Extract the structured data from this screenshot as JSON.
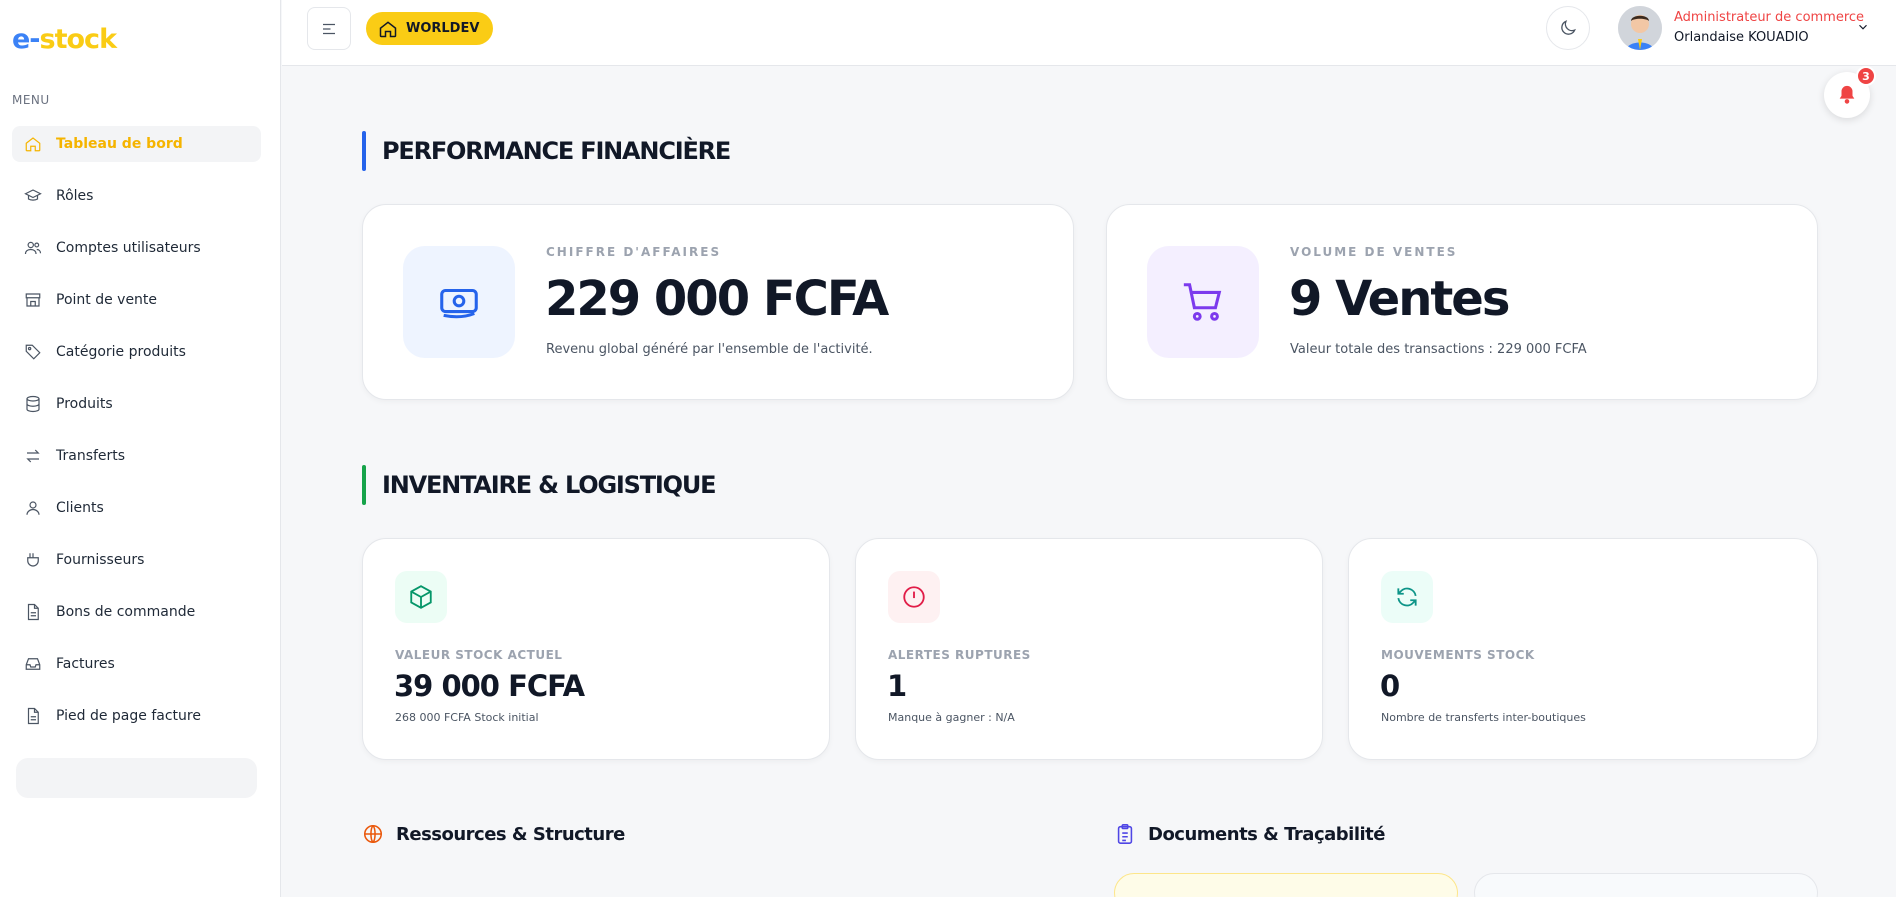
{
  "logo": {
    "part1": "e-",
    "part2": "stock"
  },
  "sidebar": {
    "menu_label": "MENU",
    "items": [
      {
        "label": "Tableau de bord",
        "icon": "home-icon",
        "active": true
      },
      {
        "label": "Rôles",
        "icon": "graduation-cap-icon"
      },
      {
        "label": "Comptes utilisateurs",
        "icon": "users-icon"
      },
      {
        "label": "Point de vente",
        "icon": "store-icon"
      },
      {
        "label": "Catégorie produits",
        "icon": "tag-icon"
      },
      {
        "label": "Produits",
        "icon": "database-icon"
      },
      {
        "label": "Transferts",
        "icon": "arrows-exchange-icon"
      },
      {
        "label": "Clients",
        "icon": "user-icon"
      },
      {
        "label": "Fournisseurs",
        "icon": "hand-box-icon"
      },
      {
        "label": "Bons de commande",
        "icon": "document-icon"
      },
      {
        "label": "Factures",
        "icon": "inbox-icon"
      },
      {
        "label": "Pied de page facture",
        "icon": "document-icon"
      }
    ]
  },
  "header": {
    "org_name": "WORLDEV",
    "user_role": "Administrateur de commerce",
    "user_name": "Orlandaise KOUADIO",
    "notification_count": "3"
  },
  "sections": {
    "finance_title": "PERFORMANCE FINANCIÈRE",
    "inventory_title": "INVENTAIRE & LOGISTIQUE",
    "resources_title": "Ressources & Structure",
    "documents_title": "Documents & Traçabilité"
  },
  "finance_cards": {
    "revenue": {
      "label": "CHIFFRE D'AFFAIRES",
      "value": "229 000 FCFA",
      "sub": "Revenu global généré par l'ensemble de l'activité."
    },
    "sales": {
      "label": "VOLUME DE VENTES",
      "value": "9 Ventes",
      "sub": "Valeur totale des transactions : 229 000 FCFA"
    }
  },
  "inventory_cards": {
    "stock_value": {
      "label": "VALEUR STOCK ACTUEL",
      "value": "39 000 FCFA",
      "sub": "268 000 FCFA Stock initial"
    },
    "alerts": {
      "label": "ALERTES RUPTURES",
      "value": "1",
      "sub": "Manque à gagner : N/A"
    },
    "movements": {
      "label": "MOUVEMENTS STOCK",
      "value": "0",
      "sub": "Nombre de transferts inter-boutiques"
    }
  },
  "colors": {
    "accent_yellow": "#facc15",
    "active_nav": "#f5b400",
    "finance_bar": "#2563eb",
    "inventory_bar": "#16a34a",
    "role_red": "#ef4444",
    "revenue_icon_bg": "#eef4ff",
    "sales_icon_bg": "#f4efff",
    "stock_icon_bg": "#ecfdf5",
    "alert_icon_bg": "#fef1f2",
    "movement_icon_bg": "#ecfdf8"
  }
}
